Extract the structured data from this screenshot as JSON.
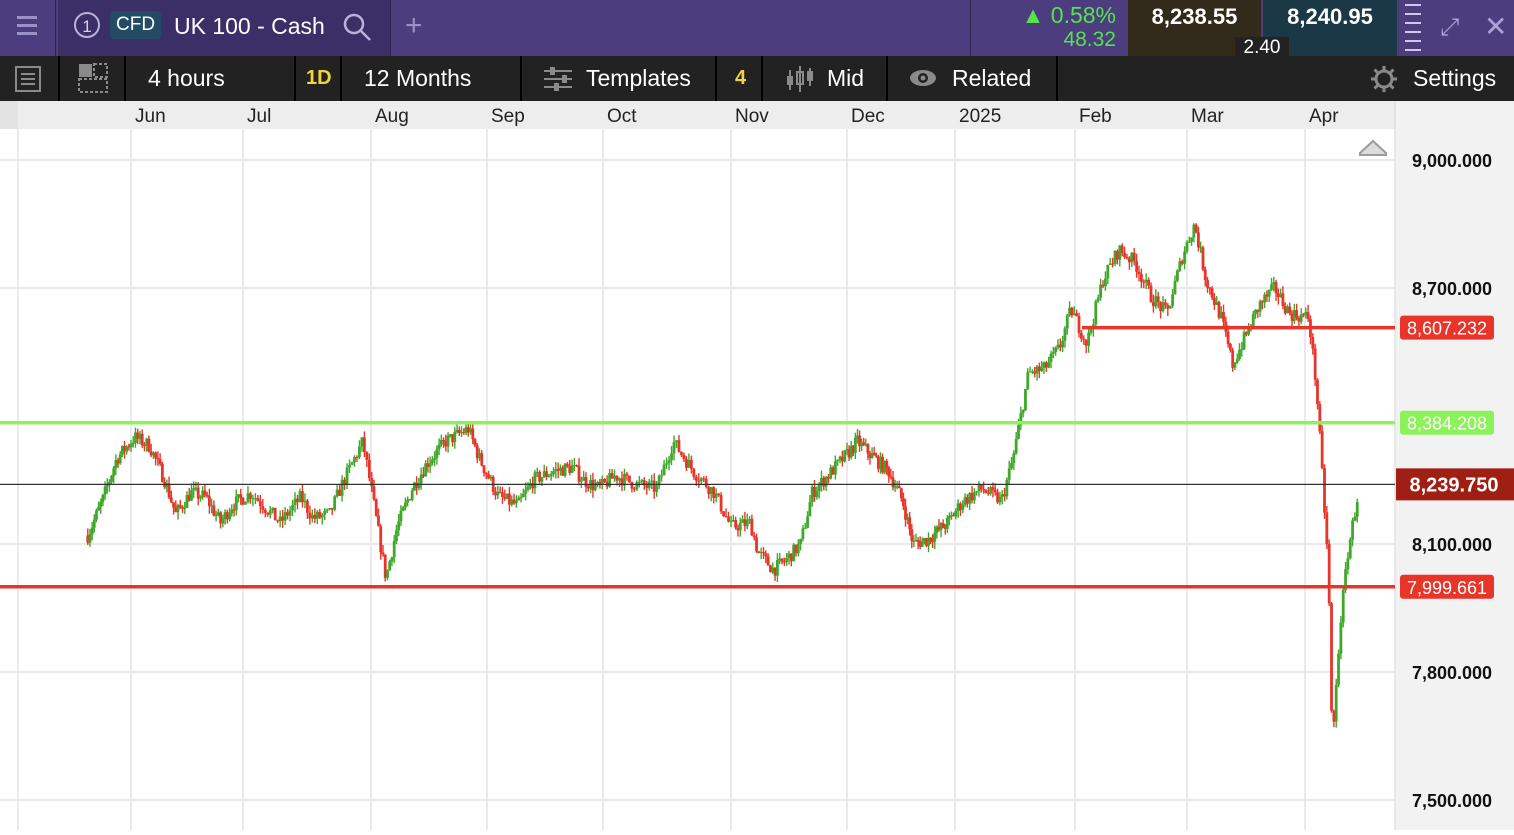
{
  "header": {
    "instrument_number": "1",
    "instrument_type": "CFD",
    "instrument_name": "UK 100 - Cash",
    "change_percent": "▲ 0.58%",
    "change_points": "48.32",
    "sell_price": "8,238.55",
    "buy_price": "8,240.95",
    "spread": "2.40",
    "colors": {
      "bar": "#4c3d7e",
      "positive": "#55e34a"
    },
    "icons": [
      "menu-icon",
      "search-icon",
      "plus-icon",
      "drag-handle-icon",
      "expand-icon",
      "close-icon"
    ]
  },
  "toolbar": {
    "interval": "4 hours",
    "interval_badge": "1D",
    "range": "12 Months",
    "templates_label": "Templates",
    "templates_count": "4",
    "price_mode": "Mid",
    "related_label": "Related",
    "settings_label": "Settings",
    "icons": [
      "list-icon",
      "layout-icon",
      "templates-icon",
      "candles-icon",
      "eye-icon",
      "gear-icon"
    ]
  },
  "chart_data": {
    "type": "candlestick",
    "title": "",
    "time_labels": [
      "Jun",
      "Jul",
      "Aug",
      "Sep",
      "Oct",
      "Nov",
      "Dec",
      "2025",
      "Feb",
      "Mar",
      "Apr"
    ],
    "y_ticks": [
      9000,
      8700,
      8100,
      7800,
      7500
    ],
    "y_tick_labels": [
      "9,000.000",
      "8,700.000",
      "8,100.000",
      "7,800.000",
      "7,500.000"
    ],
    "ylim": [
      7440,
      9070
    ],
    "grid": true,
    "current_price": {
      "value": 8239.75,
      "label": "8,239.750"
    },
    "horizontal_lines": [
      {
        "value": 8607.232,
        "label": "8,607.232",
        "color": "#e8352a",
        "from": "Feb"
      },
      {
        "value": 8384.208,
        "label": "8,384.208",
        "color": "#8cf25a",
        "from": "start"
      },
      {
        "value": 7999.661,
        "label": "7,999.661",
        "color": "#e8352a",
        "from": "start"
      }
    ],
    "price_path": [
      [
        "May-20",
        8120
      ],
      [
        "May-24",
        8200
      ],
      [
        "May-28",
        8300
      ],
      [
        "Jun-02",
        8350
      ],
      [
        "Jun-06",
        8330
      ],
      [
        "Jun-10",
        8250
      ],
      [
        "Jun-13",
        8170
      ],
      [
        "Jun-17",
        8220
      ],
      [
        "Jun-21",
        8210
      ],
      [
        "Jun-25",
        8150
      ],
      [
        "Jun-28",
        8190
      ],
      [
        "Jul-03",
        8220
      ],
      [
        "Jul-07",
        8180
      ],
      [
        "Jul-10",
        8150
      ],
      [
        "Jul-15",
        8210
      ],
      [
        "Jul-18",
        8160
      ],
      [
        "Jul-22",
        8170
      ],
      [
        "Jul-25",
        8240
      ],
      [
        "Jul-30",
        8340
      ],
      [
        "Aug-02",
        8180
      ],
      [
        "Aug-05",
        8020
      ],
      [
        "Aug-08",
        8140
      ],
      [
        "Aug-12",
        8230
      ],
      [
        "Aug-16",
        8290
      ],
      [
        "Aug-21",
        8340
      ],
      [
        "Aug-27",
        8370
      ],
      [
        "Aug-30",
        8300
      ],
      [
        "Sep-04",
        8210
      ],
      [
        "Sep-09",
        8190
      ],
      [
        "Sep-13",
        8250
      ],
      [
        "Sep-18",
        8270
      ],
      [
        "Sep-23",
        8280
      ],
      [
        "Sep-26",
        8250
      ],
      [
        "Sep-30",
        8230
      ],
      [
        "Oct-04",
        8260
      ],
      [
        "Oct-09",
        8240
      ],
      [
        "Oct-14",
        8230
      ],
      [
        "Oct-18",
        8340
      ],
      [
        "Oct-23",
        8270
      ],
      [
        "Oct-28",
        8220
      ],
      [
        "Nov-01",
        8140
      ],
      [
        "Nov-06",
        8150
      ],
      [
        "Nov-08",
        8080
      ],
      [
        "Nov-12",
        8040
      ],
      [
        "Nov-15",
        8060
      ],
      [
        "Nov-19",
        8100
      ],
      [
        "Nov-22",
        8220
      ],
      [
        "Nov-26",
        8260
      ],
      [
        "Nov-30",
        8300
      ],
      [
        "Dec-04",
        8340
      ],
      [
        "Dec-09",
        8300
      ],
      [
        "Dec-13",
        8270
      ],
      [
        "Dec-17",
        8200
      ],
      [
        "Dec-20",
        8100
      ],
      [
        "Dec-24",
        8110
      ],
      [
        "Dec-30",
        8150
      ],
      [
        "Jan-03",
        8200
      ],
      [
        "Jan-08",
        8230
      ],
      [
        "Jan-13",
        8200
      ],
      [
        "Jan-16",
        8300
      ],
      [
        "Jan-20",
        8500
      ],
      [
        "Jan-24",
        8510
      ],
      [
        "Jan-28",
        8560
      ],
      [
        "Jan-31",
        8650
      ],
      [
        "Feb-04",
        8570
      ],
      [
        "Feb-08",
        8720
      ],
      [
        "Feb-12",
        8790
      ],
      [
        "Feb-16",
        8760
      ],
      [
        "Feb-20",
        8680
      ],
      [
        "Feb-24",
        8640
      ],
      [
        "Feb-28",
        8780
      ],
      [
        "Mar-03",
        8850
      ],
      [
        "Mar-06",
        8720
      ],
      [
        "Mar-10",
        8630
      ],
      [
        "Mar-13",
        8520
      ],
      [
        "Mar-16",
        8580
      ],
      [
        "Mar-20",
        8660
      ],
      [
        "Mar-24",
        8700
      ],
      [
        "Mar-28",
        8640
      ],
      [
        "Apr-02",
        8630
      ],
      [
        "Apr-04",
        8460
      ],
      [
        "Apr-07",
        8040
      ],
      [
        "Apr-08",
        7620
      ],
      [
        "Apr-10",
        7910
      ],
      [
        "Apr-12",
        8080
      ],
      [
        "Apr-15",
        8240
      ]
    ],
    "series_colors": {
      "up": "#3fa82a",
      "down": "#e8352a"
    }
  }
}
